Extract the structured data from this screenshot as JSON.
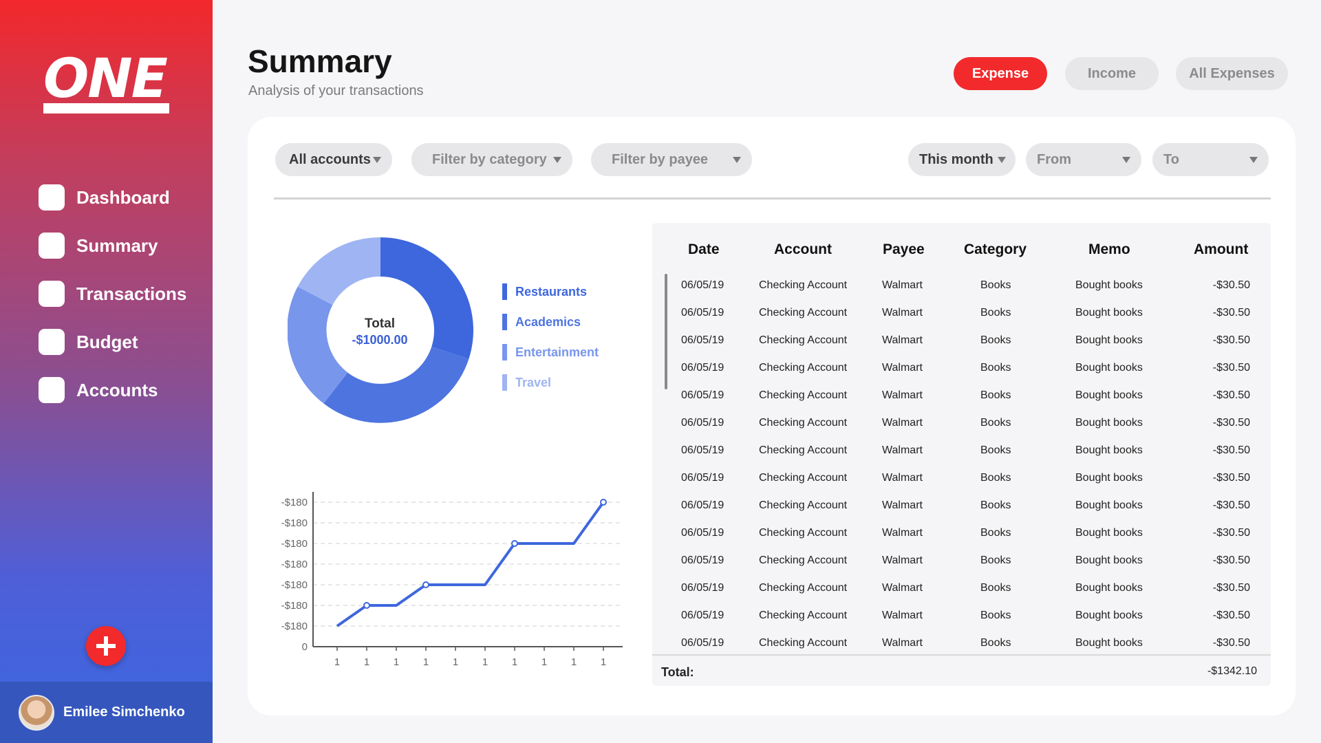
{
  "app": {
    "logo_text": "ONE"
  },
  "sidebar": {
    "items": [
      {
        "label": "Dashboard"
      },
      {
        "label": "Summary"
      },
      {
        "label": "Transactions"
      },
      {
        "label": "Budget"
      },
      {
        "label": "Accounts"
      }
    ],
    "user_name": "Emilee Simchenko"
  },
  "header": {
    "title": "Summary",
    "subtitle": "Analysis of your transactions",
    "tabs": [
      {
        "label": "Expense",
        "active": true
      },
      {
        "label": "Income",
        "active": false
      },
      {
        "label": "All Expenses",
        "active": false
      }
    ]
  },
  "filters": {
    "account": "All accounts",
    "category": "Filter by category",
    "payee": "Filter by payee",
    "period": "This month",
    "from": "From",
    "to": "To"
  },
  "donut": {
    "total_label": "Total",
    "total_value": "-$1000.00",
    "legend": [
      {
        "label": "Restaurants",
        "color": "#3e67dd"
      },
      {
        "label": "Academics",
        "color": "#4e74e0"
      },
      {
        "label": "Entertainment",
        "color": "#7896ec"
      },
      {
        "label": "Travel",
        "color": "#9fb4f2"
      }
    ]
  },
  "chart_data": {
    "type": "line",
    "x": [
      "1",
      "1",
      "1",
      "1",
      "1",
      "1",
      "1",
      "1",
      "1",
      "1"
    ],
    "y_tick_labels": [
      "0",
      "-$180",
      "-$180",
      "-$180",
      "-$180",
      "-$180",
      "-$180",
      "-$180"
    ],
    "series": [
      {
        "values": [
          1,
          2,
          2,
          3,
          3,
          3,
          5,
          5,
          5,
          7
        ],
        "markers_at": [
          1,
          3,
          6,
          9
        ]
      }
    ],
    "ylim": [
      0,
      7
    ],
    "grid": "dashed horizontal",
    "color": "#3e67dd"
  },
  "table": {
    "headers": [
      "Date",
      "Account",
      "Payee",
      "Category",
      "Memo",
      "Amount"
    ],
    "rows": [
      [
        "06/05/19",
        "Checking Account",
        "Walmart",
        "Books",
        "Bought books",
        "-$30.50"
      ],
      [
        "06/05/19",
        "Checking Account",
        "Walmart",
        "Books",
        "Bought books",
        "-$30.50"
      ],
      [
        "06/05/19",
        "Checking Account",
        "Walmart",
        "Books",
        "Bought books",
        "-$30.50"
      ],
      [
        "06/05/19",
        "Checking Account",
        "Walmart",
        "Books",
        "Bought books",
        "-$30.50"
      ],
      [
        "06/05/19",
        "Checking Account",
        "Walmart",
        "Books",
        "Bought books",
        "-$30.50"
      ],
      [
        "06/05/19",
        "Checking Account",
        "Walmart",
        "Books",
        "Bought books",
        "-$30.50"
      ],
      [
        "06/05/19",
        "Checking Account",
        "Walmart",
        "Books",
        "Bought books",
        "-$30.50"
      ],
      [
        "06/05/19",
        "Checking Account",
        "Walmart",
        "Books",
        "Bought books",
        "-$30.50"
      ],
      [
        "06/05/19",
        "Checking Account",
        "Walmart",
        "Books",
        "Bought books",
        "-$30.50"
      ],
      [
        "06/05/19",
        "Checking Account",
        "Walmart",
        "Books",
        "Bought books",
        "-$30.50"
      ],
      [
        "06/05/19",
        "Checking Account",
        "Walmart",
        "Books",
        "Bought books",
        "-$30.50"
      ],
      [
        "06/05/19",
        "Checking Account",
        "Walmart",
        "Books",
        "Bought books",
        "-$30.50"
      ],
      [
        "06/05/19",
        "Checking Account",
        "Walmart",
        "Books",
        "Bought books",
        "-$30.50"
      ],
      [
        "06/05/19",
        "Checking Account",
        "Walmart",
        "Books",
        "Bought books",
        "-$30.50"
      ]
    ],
    "total_label": "Total:",
    "total_value": "-$1342.10"
  },
  "colors": {
    "accent": "#f22a2c",
    "primary_blue": "#3e67dd"
  }
}
